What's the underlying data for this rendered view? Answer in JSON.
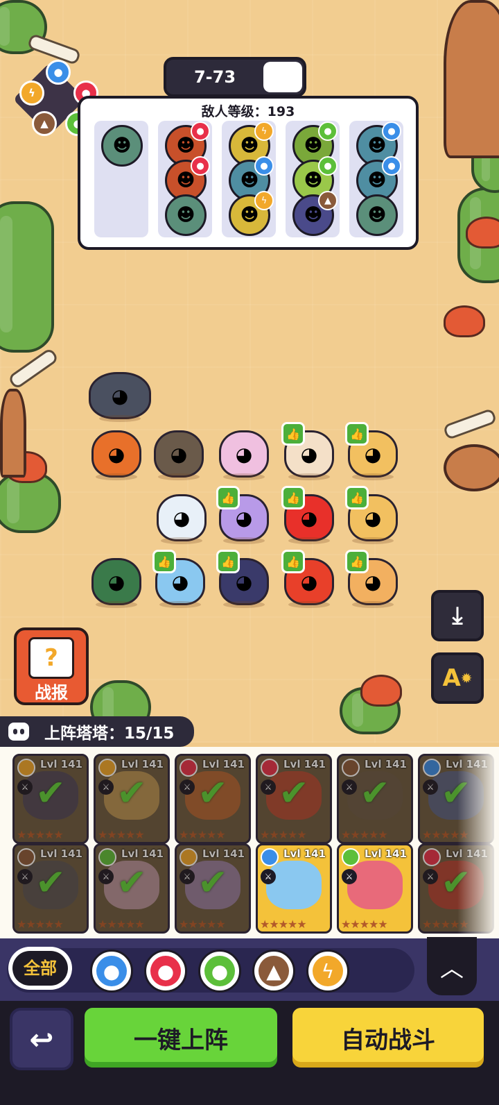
{
  "stage": {
    "label": "7-73"
  },
  "enemy_panel": {
    "level_text": "敌人等级：193"
  },
  "side_buttons": {
    "report_label": "战报",
    "report_icon": "question-mark-icon",
    "download_icon": "download-icon",
    "settings_icon": "auto-settings-icon",
    "settings_glyph": "A"
  },
  "deploy": {
    "label": "上阵塔塔：15/15"
  },
  "roster": {
    "row1": [
      {
        "lvl": "Lvl 141",
        "element": "lightning",
        "deployed": true
      },
      {
        "lvl": "Lvl 141",
        "element": "lightning",
        "deployed": true
      },
      {
        "lvl": "Lvl 141",
        "element": "fire",
        "deployed": true
      },
      {
        "lvl": "Lvl 141",
        "element": "fire",
        "deployed": true
      },
      {
        "lvl": "Lvl 141",
        "element": "earth",
        "deployed": true
      },
      {
        "lvl": "Lvl 141",
        "element": "water",
        "deployed": true
      }
    ],
    "row2": [
      {
        "lvl": "Lvl 141",
        "element": "earth",
        "deployed": true
      },
      {
        "lvl": "Lvl 141",
        "element": "nature",
        "deployed": true
      },
      {
        "lvl": "Lvl 141",
        "element": "lightning",
        "deployed": true
      },
      {
        "lvl": "Lvl 141",
        "element": "water",
        "deployed": false
      },
      {
        "lvl": "Lvl 141",
        "element": "nature",
        "deployed": false
      },
      {
        "lvl": "Lvl 141",
        "element": "fire",
        "deployed": true
      }
    ]
  },
  "filters": {
    "all_label": "全部",
    "elements": [
      "water",
      "fire",
      "nature",
      "earth",
      "lightning"
    ]
  },
  "actions": {
    "one_click_deploy": "一键上阵",
    "auto_battle": "自动战斗"
  },
  "colors": {
    "water": "#3a8ee8",
    "fire": "#e8304a",
    "nature": "#5cbf3a",
    "earth": "#8a5a3a",
    "lightning": "#f2a82a"
  }
}
